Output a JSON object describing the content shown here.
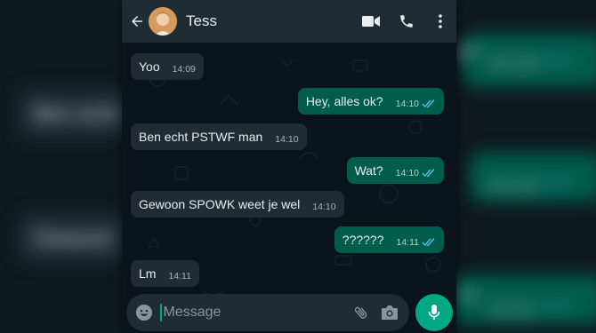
{
  "contact": {
    "name": "Tess"
  },
  "messages": [
    {
      "dir": "in",
      "text": "Yoo",
      "time": "14:09"
    },
    {
      "dir": "out",
      "text": "Hey, alles ok?",
      "time": "14:10"
    },
    {
      "dir": "in",
      "text": "Ben echt PSTWF man",
      "time": "14:10"
    },
    {
      "dir": "out",
      "text": "Wat?",
      "time": "14:10"
    },
    {
      "dir": "in",
      "text": "Gewoon SPOWK weet je wel",
      "time": "14:10"
    },
    {
      "dir": "out",
      "text": "??????",
      "time": "14:11"
    },
    {
      "dir": "in",
      "text": "Lm",
      "time": "14:11"
    }
  ],
  "composer": {
    "placeholder": "Message"
  },
  "background": {
    "texts": [
      "Ben echt",
      "Gewoon",
      "k?",
      "??"
    ],
    "times": [
      "14:10",
      "14:10",
      "14:11"
    ]
  },
  "colors": {
    "appbar": "#1f2c34",
    "incoming": "#1f2c34",
    "outgoing": "#005c4b",
    "accent": "#00a884",
    "read_tick": "#53bdeb",
    "chat_bg": "#0b141a"
  },
  "icons": [
    "back-arrow-icon",
    "video-call-icon",
    "phone-icon",
    "more-vert-icon",
    "emoji-icon",
    "attach-icon",
    "camera-icon",
    "mic-icon",
    "double-check-icon"
  ]
}
